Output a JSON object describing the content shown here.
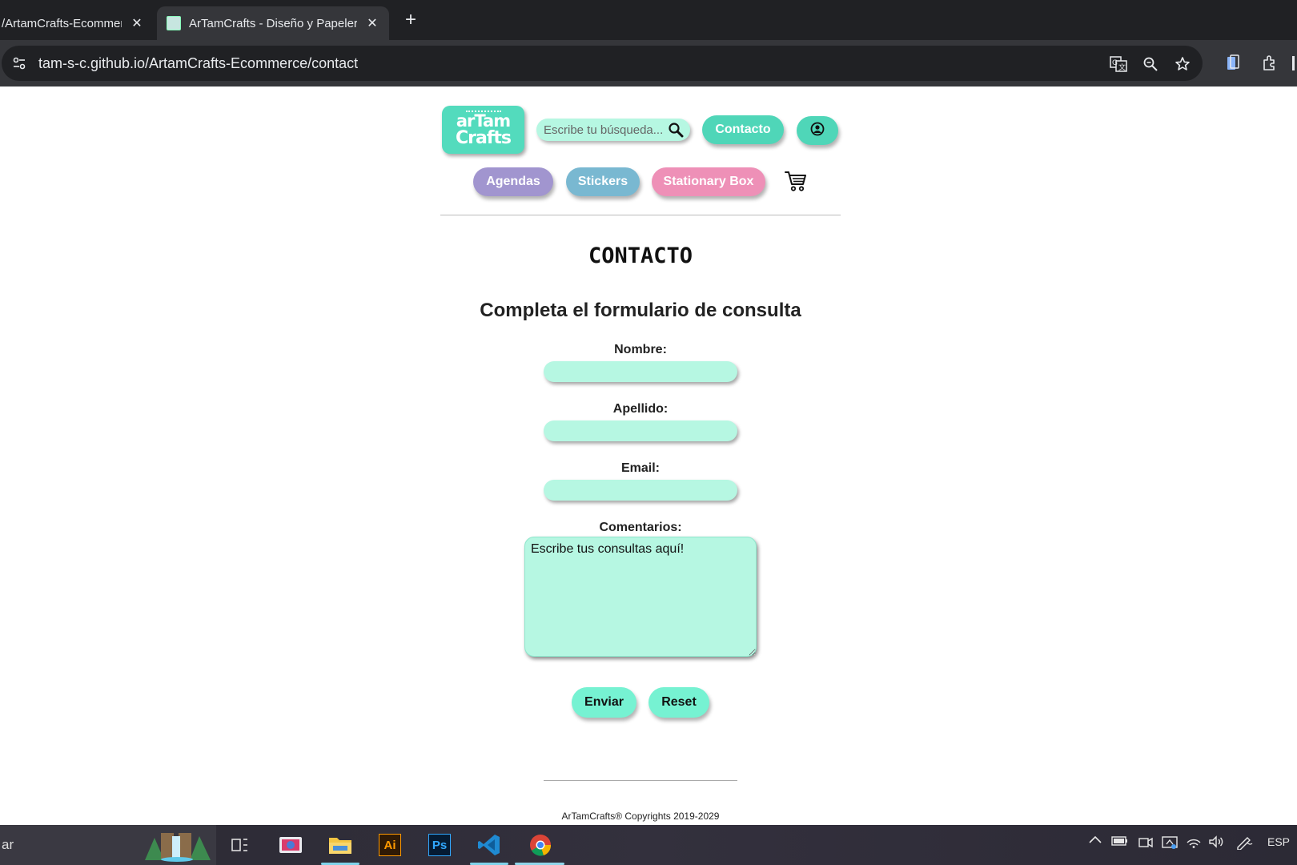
{
  "browser": {
    "tabs": [
      {
        "title": "/ArtamCrafts-Ecommerce",
        "active": false
      },
      {
        "title": "ArTamCrafts - Diseño y Papelería",
        "active": true
      }
    ],
    "url": "tam-s-c.github.io/ArtamCrafts-Ecommerce/contact",
    "new_tab_symbol": "+",
    "close_symbol": "✕"
  },
  "site": {
    "logo": {
      "line1": "arTam",
      "line2": "Crafts"
    },
    "search_placeholder": "Escribe tu búsqueda...",
    "contact_button": "Contacto",
    "nav": [
      "Agendas",
      "Stickers",
      "Stationary Box"
    ],
    "colors": {
      "accent": "#4fd6b8",
      "field": "#b6f7e2",
      "agendas": "#a195cf",
      "stickers": "#79b8d1",
      "stationary": "#ee90b7",
      "action": "#76f2d2"
    }
  },
  "contact": {
    "title": "CONTACTO",
    "subtitle": "Completa el formulario de consulta",
    "labels": {
      "nombre": "Nombre:",
      "apellido": "Apellido:",
      "email": "Email:",
      "comentarios": "Comentarios:"
    },
    "comments_value": "Escribe tus consultas aquí!",
    "submit": "Enviar",
    "reset": "Reset"
  },
  "footer": {
    "text": "ArTamCrafts® Copyrights 2019-2029"
  },
  "taskbar": {
    "search_stub": "ar",
    "language": "ESP",
    "apps": [
      "task-view",
      "photo-app",
      "file-explorer",
      "illustrator",
      "photoshop",
      "vscode",
      "chrome"
    ],
    "illustrator_label": "Ai",
    "photoshop_label": "Ps"
  }
}
